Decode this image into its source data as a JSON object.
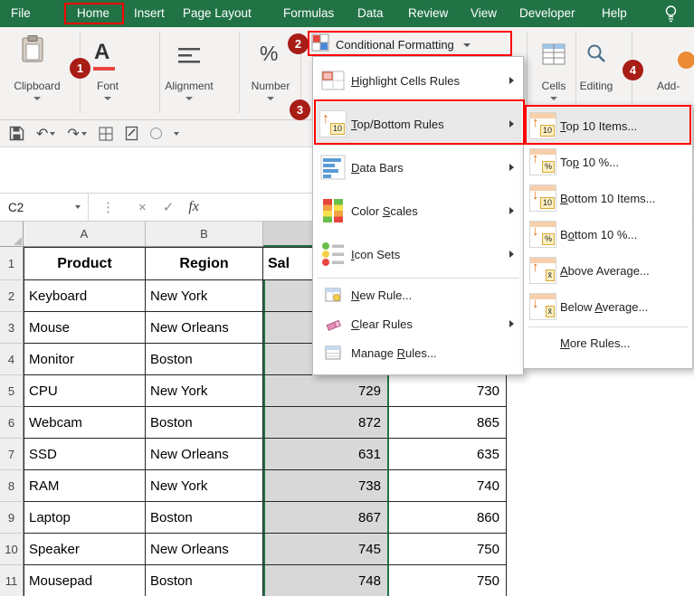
{
  "tab_bar": {
    "tabs": [
      "File",
      "Home",
      "Insert",
      "Page Layout",
      "Formulas",
      "Data",
      "Review",
      "View",
      "Developer",
      "Help"
    ]
  },
  "ribbon": {
    "clipboard_label": "Clipboard",
    "font_label": "Font",
    "alignment_label": "Alignment",
    "number_label": "Number",
    "cf_button_label": "Conditional Formatting",
    "cells_label": "Cells",
    "editing_label": "Editing",
    "addins_label": "Add-",
    "font_icon_letter": "A",
    "number_icon": "%"
  },
  "qat_glyphs": {
    "undo": "↶",
    "redo": "↷",
    "circle": "◯"
  },
  "formula_bar": {
    "name_box": "C2",
    "kebab": "⋮",
    "cancel": "×",
    "enter": "✓",
    "fx": "fx"
  },
  "annotations": {
    "badge1": "1",
    "badge2": "2",
    "badge3": "3",
    "badge4": "4"
  },
  "cf_menu": {
    "items": [
      {
        "pre": "",
        "key": "H",
        "post": "ighlight Cells Rules"
      },
      {
        "pre": "",
        "key": "T",
        "post": "op/Bottom Rules",
        "icon_arrow": "↑",
        "icon_badge": "10"
      },
      {
        "pre": "",
        "key": "D",
        "post": "ata Bars"
      },
      {
        "pre": "Color ",
        "key": "S",
        "post": "cales"
      },
      {
        "pre": "",
        "key": "I",
        "post": "con Sets"
      },
      {
        "pre": "",
        "key": "N",
        "post": "ew Rule..."
      },
      {
        "pre": "",
        "key": "C",
        "post": "lear Rules"
      },
      {
        "pre": "Manage ",
        "key": "R",
        "post": "ules..."
      }
    ]
  },
  "cf_submenu": {
    "items": [
      {
        "pre": "",
        "key": "T",
        "post": "op 10 Items...",
        "icon_arrow": "↑",
        "icon_badge": "10"
      },
      {
        "pre": "To",
        "key": "p",
        "post": " 10 %...",
        "icon_arrow": "↑",
        "icon_badge": "%"
      },
      {
        "pre": "",
        "key": "B",
        "post": "ottom 10 Items...",
        "icon_arrow": "↓",
        "icon_badge": "10"
      },
      {
        "pre": "B",
        "key": "o",
        "post": "ttom 10 %...",
        "icon_arrow": "↓",
        "icon_badge": "%"
      },
      {
        "pre": "",
        "key": "A",
        "post": "bove Average...",
        "icon_arrow": "↑",
        "icon_badge": "x̄"
      },
      {
        "pre": "Below ",
        "key": "A",
        "post": "verage...",
        "icon_arrow": "↓",
        "icon_badge": "x̄"
      },
      {
        "pre": "",
        "key": "M",
        "post": "ore Rules...",
        "icon_arrow": "",
        "icon_badge": ""
      }
    ]
  },
  "sheet": {
    "col_headers": [
      "A",
      "B"
    ],
    "rows": [
      {
        "n": "1",
        "a": "Product",
        "b": "Region",
        "c": "Sal",
        "d": ""
      },
      {
        "n": "2",
        "a": "Keyboard",
        "b": "New York",
        "c": "",
        "d": ""
      },
      {
        "n": "3",
        "a": "Mouse",
        "b": "New Orleans",
        "c": "",
        "d": ""
      },
      {
        "n": "4",
        "a": "Monitor",
        "b": "Boston",
        "c": "",
        "d": ""
      },
      {
        "n": "5",
        "a": "CPU",
        "b": "New York",
        "c": "729",
        "d": "730"
      },
      {
        "n": "6",
        "a": "Webcam",
        "b": "Boston",
        "c": "872",
        "d": "865"
      },
      {
        "n": "7",
        "a": "SSD",
        "b": "New Orleans",
        "c": "631",
        "d": "635"
      },
      {
        "n": "8",
        "a": "RAM",
        "b": "New York",
        "c": "738",
        "d": "740"
      },
      {
        "n": "9",
        "a": "Laptop",
        "b": "Boston",
        "c": "867",
        "d": "860"
      },
      {
        "n": "10",
        "a": "Speaker",
        "b": "New Orleans",
        "c": "745",
        "d": "750"
      },
      {
        "n": "11",
        "a": "Mousepad",
        "b": "Boston",
        "c": "748",
        "d": "750"
      }
    ]
  },
  "colors": {
    "excel_green": "#217346",
    "annotation_red": "#ff0000",
    "badge_red": "#a81d16",
    "selection_fill": "#d8d8d8"
  }
}
